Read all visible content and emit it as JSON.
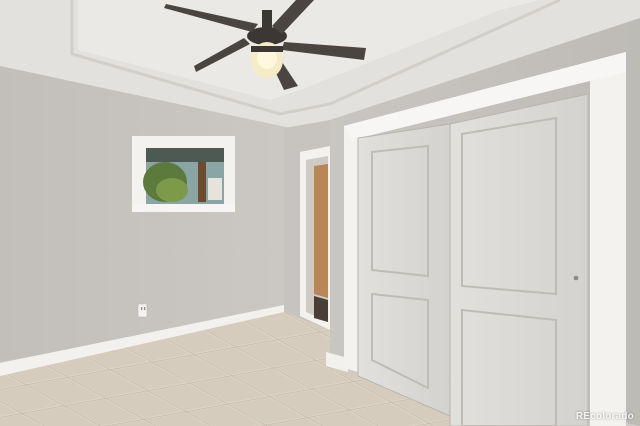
{
  "photo": {
    "subject": "empty-bedroom-interior",
    "watermark": "REcolorado"
  },
  "colors": {
    "wall": "#c9c6c1",
    "ceiling": "#e6e4e0",
    "trim": "#f3f2ef",
    "closet_door": "#dcdad6",
    "floor_tile": "#dbd1c4",
    "interior_door": "#b98658",
    "fan_body": "#3b3733"
  },
  "icons": [
    "ceiling-fan-icon",
    "outlet-icon",
    "door-knob-icon"
  ]
}
